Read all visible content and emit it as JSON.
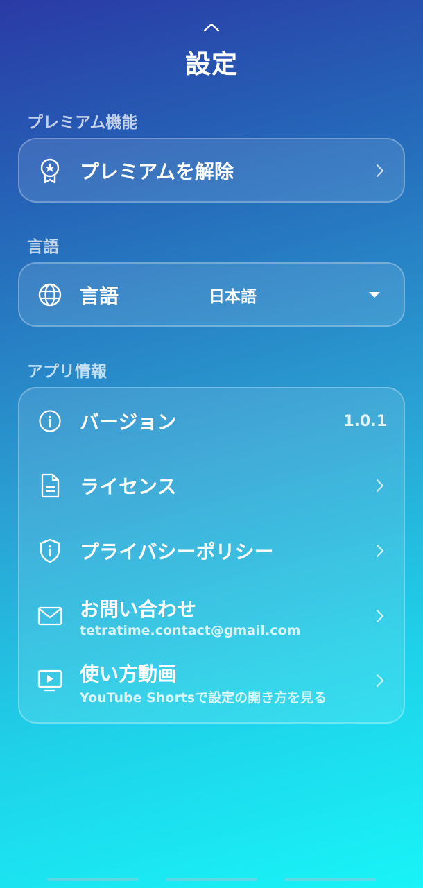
{
  "header": {
    "title": "設定",
    "collapse_icon": "chevron-up-icon"
  },
  "premium": {
    "section_label": "プレミアム機能",
    "unlock_label": "プレミアムを解除",
    "icon": "award-badge-icon"
  },
  "language": {
    "section_label": "言語",
    "label": "言語",
    "selected_value": "日本語",
    "icon": "globe-icon"
  },
  "app_info": {
    "section_label": "アプリ情報",
    "version": {
      "label": "バージョン",
      "value": "1.0.1",
      "icon": "info-circle-icon"
    },
    "license": {
      "label": "ライセンス",
      "icon": "document-icon"
    },
    "privacy": {
      "label": "プライバシーポリシー",
      "icon": "shield-info-icon"
    },
    "contact": {
      "label": "お問い合わせ",
      "email": "tetratime.contact@gmail.com",
      "icon": "mail-icon"
    },
    "tutorial": {
      "label": "使い方動画",
      "subtitle": "YouTube Shortsで設定の開き方を見る",
      "icon": "video-play-icon"
    }
  },
  "colors": {
    "gradient_top": "#2a3aa6",
    "gradient_mid": "#2aa2d4",
    "gradient_bottom": "#18f4f8",
    "text": "#ffffff"
  }
}
